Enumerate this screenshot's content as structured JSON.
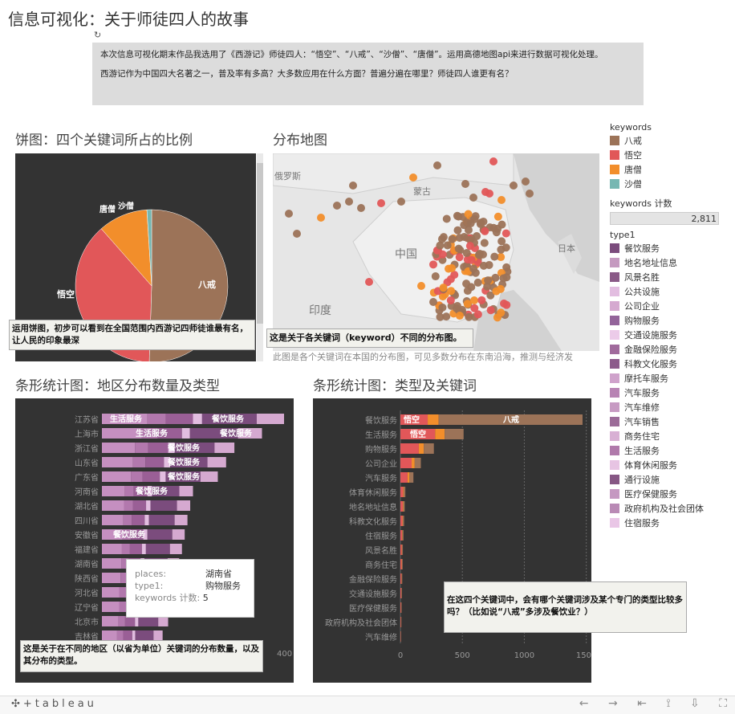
{
  "header": {
    "title": "信息可视化：关于师徒四人的故事",
    "refresh_glyph": "↻"
  },
  "intro": {
    "para1": "本次信息可视化期末作品我选用了《西游记》师徒四人：“悟空”、“八戒”、“沙僧”、“唐僧”。运用高德地图api来进行数据可视化处理。",
    "para2": "西游记作为中国四大名著之一，普及率有多高？大多数应用在什么方面？普遍分遍在哪里？师徒四人谁更有名？"
  },
  "pie": {
    "title": "饼图：四个关键词所占的比例",
    "caption": "运用饼图，初步可以看到在全国范围内西游记四师徒谁最有名，让人民的印象最深",
    "labels": {
      "bajie": "八戒",
      "wukong": "悟空",
      "tangseng": "唐僧",
      "shaseng": "沙僧"
    },
    "shares": {
      "bajie": 0.505,
      "wukong": 0.38,
      "tangseng": 0.105,
      "shaseng": 0.01
    }
  },
  "map": {
    "title": "分布地图",
    "caption": "这是关于各关键词（keyword）不同的分布图。",
    "below_text": "此图是各个关键词在本国的分布图，可见多数分布在东南沿海，推测与经济发",
    "labels": {
      "russia": "俄罗斯",
      "mongolia": "蒙古",
      "china": "中国",
      "india": "印度",
      "japan": "日本"
    }
  },
  "region_chart": {
    "title": "条形统计图：地区分布数量及类型",
    "caption": "这是关于在不同的地区（以省为单位）关键词的分布数量，以及其分布的类型。",
    "axis_tick": "400",
    "provinces": [
      "江苏省",
      "上海市",
      "浙江省",
      "山东省",
      "广东省",
      "河南省",
      "湖北省",
      "四川省",
      "安徽省",
      "福建省",
      "湖南省",
      "陕西省",
      "河北省",
      "辽宁省",
      "北京市",
      "吉林省"
    ],
    "values": [
      330,
      290,
      240,
      225,
      210,
      165,
      160,
      155,
      150,
      145,
      140,
      135,
      125,
      125,
      120,
      110
    ],
    "bar_texts": [
      {
        "row": 0,
        "text": "生活服务"
      },
      {
        "row": 0,
        "text": "餐饮服务"
      },
      {
        "row": 1,
        "text": "生活服务"
      },
      {
        "row": 1,
        "text": "餐饮服务"
      },
      {
        "row": 2,
        "text": "餐饮服务"
      },
      {
        "row": 3,
        "text": "餐饮服务"
      },
      {
        "row": 4,
        "text": "餐饮服务"
      },
      {
        "row": 5,
        "text": "餐饮服务"
      },
      {
        "row": 8,
        "text": "餐饮服务"
      }
    ],
    "tooltip": {
      "places_label": "places:",
      "places_value": "湖南省",
      "type_label": "type1:",
      "type_value": "购物服务",
      "count_label": "keywords 计数:",
      "count_value": "5"
    }
  },
  "type_chart": {
    "title": "条形统计图：类型及关键词",
    "caption": "在这四个关键词中，会有哪个关键词涉及某个专门的类型比较多吗？（比如说“八戒”多涉及餐饮业？）",
    "categories": [
      "餐饮服务",
      "生活服务",
      "购物服务",
      "公司企业",
      "汽车服务",
      "体育休闲服务",
      "地名地址信息",
      "科教文化服务",
      "住宿服务",
      "风景名胜",
      "商务住宅",
      "金融保险服务",
      "交通设施服务",
      "医疗保健服务",
      "政府机构及社会团体",
      "汽车维修"
    ],
    "values": [
      1470,
      510,
      270,
      165,
      105,
      40,
      35,
      30,
      25,
      20,
      18,
      15,
      12,
      10,
      8,
      5
    ],
    "x_ticks": [
      "0",
      "500",
      "1000",
      "1500"
    ],
    "x_tick_values": [
      0,
      500,
      1000,
      1500
    ],
    "bar_texts": {
      "wukong": "悟空",
      "bajie": "八戒"
    }
  },
  "legend": {
    "keywords_title": "keywords",
    "keywords": [
      {
        "label": "八戒",
        "color": "#9c7358"
      },
      {
        "label": "悟空",
        "color": "#e15759"
      },
      {
        "label": "唐僧",
        "color": "#f28e2b"
      },
      {
        "label": "沙僧",
        "color": "#76b7b2"
      }
    ],
    "count_title": "keywords 计数",
    "count_value": "2,811",
    "type_title": "type1",
    "types": [
      {
        "label": "餐饮服务",
        "color": "#7b4c7d"
      },
      {
        "label": "地名地址信息",
        "color": "#c59ac0"
      },
      {
        "label": "风景名胜",
        "color": "#8a5a87"
      },
      {
        "label": "公共设施",
        "color": "#e2bde0"
      },
      {
        "label": "公司企业",
        "color": "#d5a9d0"
      },
      {
        "label": "购物服务",
        "color": "#93649a"
      },
      {
        "label": "交通设施服务",
        "color": "#eccbe9"
      },
      {
        "label": "金融保险服务",
        "color": "#a06a9c"
      },
      {
        "label": "科教文化服务",
        "color": "#8c5a8b"
      },
      {
        "label": "摩托车服务",
        "color": "#cfa2cb"
      },
      {
        "label": "汽车服务",
        "color": "#b884b4"
      },
      {
        "label": "汽车维修",
        "color": "#c79bc3"
      },
      {
        "label": "汽车销售",
        "color": "#9b6b98"
      },
      {
        "label": "商务住宅",
        "color": "#d8b0d4"
      },
      {
        "label": "生活服务",
        "color": "#b07aab"
      },
      {
        "label": "体育休闲服务",
        "color": "#e7c4e3"
      },
      {
        "label": "通行设施",
        "color": "#865784"
      },
      {
        "label": "医疗保健服务",
        "color": "#c598c1"
      },
      {
        "label": "政府机构及社会团体",
        "color": "#b98ab5"
      },
      {
        "label": "住宿服务",
        "color": "#e9c6e6"
      }
    ]
  },
  "footer": {
    "logo": "✣+tableau",
    "icons": [
      "undo-icon",
      "redo-icon",
      "revert-icon",
      "share-icon",
      "download-icon",
      "fullscreen-icon"
    ]
  }
}
